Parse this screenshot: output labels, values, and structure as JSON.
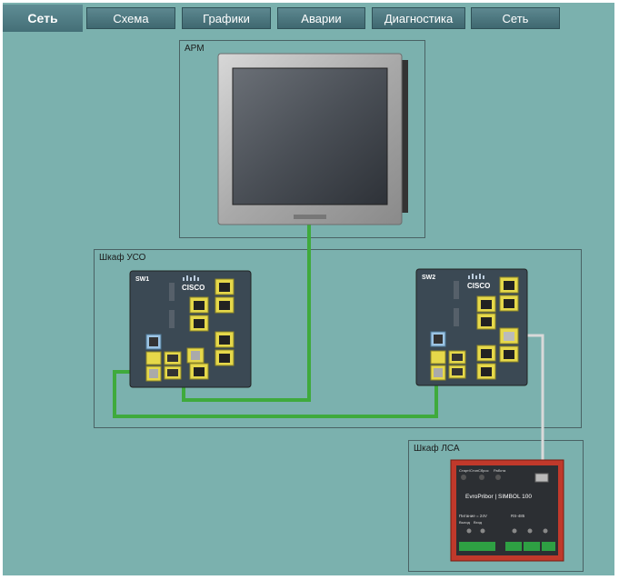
{
  "nav": {
    "title": "Сеть",
    "tabs": [
      {
        "label": "Схема"
      },
      {
        "label": "Графики"
      },
      {
        "label": "Аварии"
      },
      {
        "label": "Диагностика"
      },
      {
        "label": "Сеть"
      }
    ]
  },
  "groups": {
    "arm": "АРМ",
    "uso": "Шкаф УСО",
    "lsa": "Шкаф ЛСА"
  },
  "switches": {
    "sw1": {
      "label": "SW1",
      "brand": "CISCO"
    },
    "sw2": {
      "label": "SW2",
      "brand": "CISCO"
    }
  },
  "controller": {
    "brand": "EvroPribor | SIMBOL 100",
    "led_labels": [
      "Старт/Стоп",
      "Сброс",
      "Работа"
    ],
    "power_label": "Питание = 24V",
    "io_labels": [
      "Выход",
      "Вход"
    ],
    "rs485_label": "RS-485"
  },
  "colors": {
    "background": "#7bb1ae",
    "ethernet_cable": "#3faa3c",
    "serial_cable": "#d9d9d9",
    "port_yellow": "#e6d84a",
    "controller_border": "#c0392b"
  }
}
